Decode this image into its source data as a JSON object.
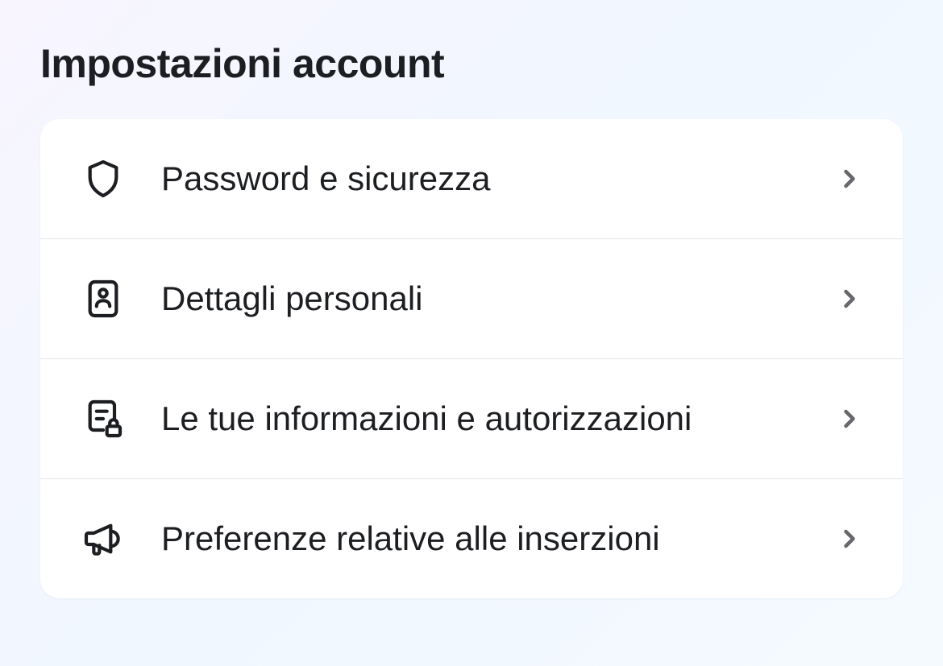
{
  "page": {
    "title": "Impostazioni account"
  },
  "settings": {
    "items": [
      {
        "label": "Password e sicurezza",
        "icon": "shield"
      },
      {
        "label": "Dettagli personali",
        "icon": "id-card"
      },
      {
        "label": "Le tue informazioni e autorizzazioni",
        "icon": "document-lock"
      },
      {
        "label": "Preferenze relative alle inserzioni",
        "icon": "megaphone"
      }
    ]
  }
}
